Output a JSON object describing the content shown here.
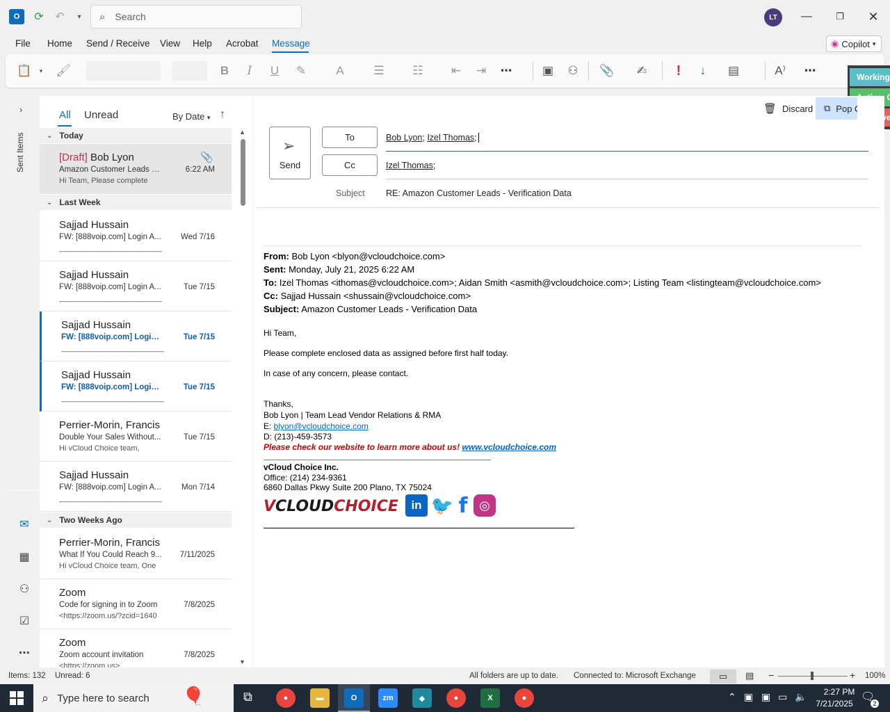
{
  "titlebar": {
    "search_placeholder": "Search",
    "avatar_initials": "LT"
  },
  "menu": [
    "File",
    "Home",
    "Send / Receive",
    "View",
    "Help",
    "Acrobat",
    "Message"
  ],
  "copilot_label": "Copilot",
  "status_pills": [
    {
      "label": "Working",
      "color": "#5bbfc9"
    },
    {
      "label": "Active: C",
      "color": "#58c06a"
    },
    {
      "label": "In Active",
      "color": "#e3605c"
    }
  ],
  "navrail": {
    "sent_items": "Sent Items"
  },
  "maillist": {
    "filter_all": "All",
    "filter_unread": "Unread",
    "sort": "By Date",
    "groups": {
      "today": "Today",
      "last_week": "Last Week",
      "two_weeks": "Two Weeks Ago"
    },
    "items": [
      {
        "draft": "[Draft]",
        "sender": " Bob Lyon",
        "subject": "Amazon Customer Leads - ...",
        "date": "6:22 AM",
        "preview": "Hi Team,  Please complete"
      },
      {
        "sender": "Sajjad Hussain",
        "subject": "FW: [888voip.com] Login A...",
        "date": "Wed 7/16",
        "preview": "___________________________"
      },
      {
        "sender": "Sajjad Hussain",
        "subject": "FW: [888voip.com] Login A...",
        "date": "Tue 7/15",
        "preview": "___________________________"
      },
      {
        "sender": "Sajjad Hussain",
        "subject": "FW: [888voip.com] Login ...",
        "date": "Tue 7/15",
        "preview": "___________________________"
      },
      {
        "sender": "Sajjad Hussain",
        "subject": "FW: [888voip.com] Login ...",
        "date": "Tue 7/15",
        "preview": "___________________________"
      },
      {
        "sender": "Perrier-Morin, Francis",
        "subject": "Double Your Sales Without...",
        "date": "Tue 7/15",
        "preview": "Hi vCloud Choice team,"
      },
      {
        "sender": "Sajjad Hussain",
        "subject": "FW: [888voip.com] Login A...",
        "date": "Mon 7/14",
        "preview": "___________________________"
      },
      {
        "sender": "Perrier-Morin, Francis",
        "subject": "What If You Could Reach 9...",
        "date": "7/11/2025",
        "preview": "Hi vCloud Choice team,  One"
      },
      {
        "sender": "Zoom",
        "subject": "Code for signing in to Zoom",
        "date": "7/8/2025",
        "preview": "<https://zoom.us/?zcid=1640"
      },
      {
        "sender": "Zoom",
        "subject": "Zoom account invitation",
        "date": "7/8/2025",
        "preview": "<https://zoom.us>"
      }
    ]
  },
  "compose": {
    "discard": "Discard",
    "popout": "Pop Out",
    "send": "Send",
    "to_label": "To",
    "cc_label": "Cc",
    "to_recipients": [
      "Bob Lyon",
      "Izel Thomas"
    ],
    "cc_recipients": [
      "Izel Thomas"
    ],
    "subject_label": "Subject",
    "subject": "RE: Amazon Customer Leads -  Verification Data"
  },
  "original": {
    "from_label": "From:",
    "from": " Bob Lyon <blyon@vcloudchoice.com>",
    "sent_label": "Sent:",
    "sent": " Monday, July 21, 2025 6:22 AM",
    "to_label": "To:",
    "to": " Izel Thomas <ithomas@vcloudchoice.com>; Aidan Smith <asmith@vcloudchoice.com>; Listing Team <listingteam@vcloudchoice.com>",
    "cc_label": "Cc:",
    "cc": " Sajjad Hussain <shussain@vcloudchoice.com>",
    "subject_label": "Subject:",
    "subject": " Amazon Customer Leads - Verification Data",
    "greeting": "Hi Team,",
    "line1": "Please complete enclosed data as assigned before first half today.",
    "line2": "In case of any concern, please contact.",
    "thanks": "Thanks,",
    "sig_name": "Bob Lyon | Team Lead Vendor Relations & RMA",
    "sig_email_label": "E: ",
    "sig_email": "blyon@vcloudchoice.com",
    "sig_phone": "D: (213)-459-3573",
    "promo": "Please check our website to learn more about us! ",
    "promo_link": "www.vcloudchoice.com",
    "company": "vCloud Choice Inc.",
    "office": "Office: (214) 234-9361",
    "address": "6860 Dallas Pkwy Suite 200 Plano, TX 75024"
  },
  "statusbar": {
    "items": "Items: 132",
    "unread": "Unread: 6",
    "sync": "All folders are up to date.",
    "connection": "Connected to: Microsoft Exchange",
    "zoom": "100%"
  },
  "taskbar": {
    "search_placeholder": "Type here to search",
    "time": "2:27 PM",
    "date": "7/21/2025",
    "notif_count": "2"
  }
}
